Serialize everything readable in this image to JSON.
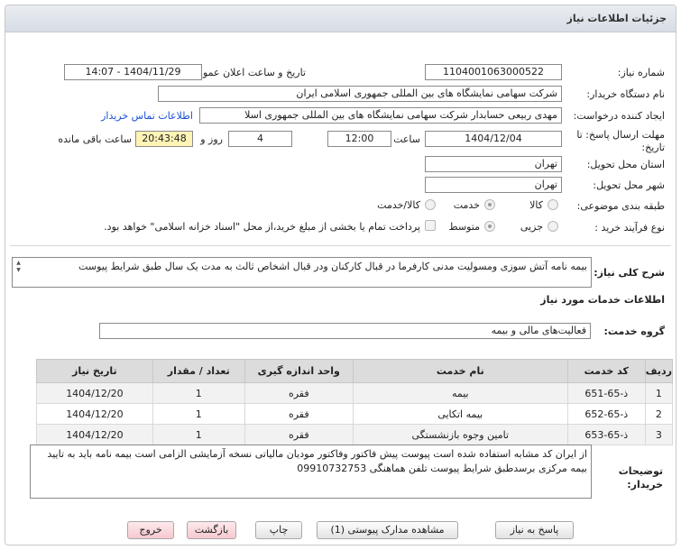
{
  "window": {
    "title": "جزئیات اطلاعات نیاز"
  },
  "fields": {
    "need_number_label": "شماره نیاز:",
    "need_number": "1104001063000522",
    "announce_label": "تاریخ و ساعت اعلان عمومی:",
    "announce_value": "1404/11/29 - 14:07",
    "buyer_org_label": "نام دستگاه خریدار:",
    "buyer_org": "شرکت سهامی نمایشگاه های بین المللی جمهوری اسلامی ایران",
    "requester_label": "ایجاد کننده درخواست:",
    "requester": "مهدی  ربیعی حسابدار شرکت سهامی نمایشگاه های بین المللی جمهوری اسلا",
    "contact_link": "اطلاعات تماس خریدار",
    "deadline_label_1": "مهلت ارسال پاسخ: تا",
    "deadline_label_2": "تاریخ:",
    "deadline_date": "1404/12/04",
    "time_label": "ساعت",
    "deadline_time": "12:00",
    "days_value": "4",
    "days_label": "روز و",
    "remaining_time": "20:43:48",
    "remaining_label": "ساعت باقی مانده",
    "province_label": "استان محل تحویل:",
    "province": "تهران",
    "city_label": "شهر محل تحویل:",
    "city": "تهران",
    "category_label": "طبقه بندی موضوعی:",
    "category_options": [
      "کالا",
      "خدمت",
      "کالا/خدمت"
    ],
    "category_selected": "خدمت",
    "process_label": "نوع فرآیند خرید :",
    "process_options": [
      "جزیی",
      "متوسط"
    ],
    "process_selected": "متوسط",
    "treasury_note": "پرداخت تمام یا بخشی از مبلغ خرید،از محل \"اسناد خزانه اسلامی\" خواهد بود."
  },
  "summary": {
    "label": "شرح کلی نیاز:",
    "text": "بیمه نامه آتش سوزی ومسولیت مدنی کارفرما در قبال کارکنان ودر قبال اشخاص ثالث به مدت یک سال طبق شرایط پیوست"
  },
  "services": {
    "section_title": "اطلاعات خدمات مورد نیاز",
    "group_label": "گروه خدمت:",
    "group_value": "فعالیت‌های مالی و بیمه",
    "columns": [
      "ردیف",
      "کد خدمت",
      "نام خدمت",
      "واحد اندازه گیری",
      "تعداد / مقدار",
      "تاریخ نیاز"
    ],
    "rows": [
      [
        "1",
        "ذ-65-651",
        "بیمه",
        "فقره",
        "1",
        "1404/12/20"
      ],
      [
        "2",
        "ذ-65-652",
        "بیمه اتکایی",
        "فقره",
        "1",
        "1404/12/20"
      ],
      [
        "3",
        "ذ-65-653",
        "تامین وجوه بازنشستگی",
        "فقره",
        "1",
        "1404/12/20"
      ]
    ]
  },
  "buyer_notes": {
    "label_1": "توضیحات",
    "label_2": "خریدار:",
    "text": "از ایران کد مشابه استفاده شده است پیوست پیش فاکتور وفاکتور مودیان مالیاتی نسخه آزمایشی الزامی است بیمه نامه باید به تایید بیمه مرکزی برسدطبق شرایط پیوست تلفن هماهنگی 09910732753"
  },
  "buttons": {
    "reply": "پاسخ به نیاز",
    "view_docs": "مشاهده مدارک پیوستی (1)",
    "print": "چاپ",
    "back": "بازگشت",
    "exit": "خروج"
  },
  "colors": {
    "link": "#1a4fd6",
    "highlight": "#fff3b6",
    "back_button": "#f6c9cf"
  }
}
